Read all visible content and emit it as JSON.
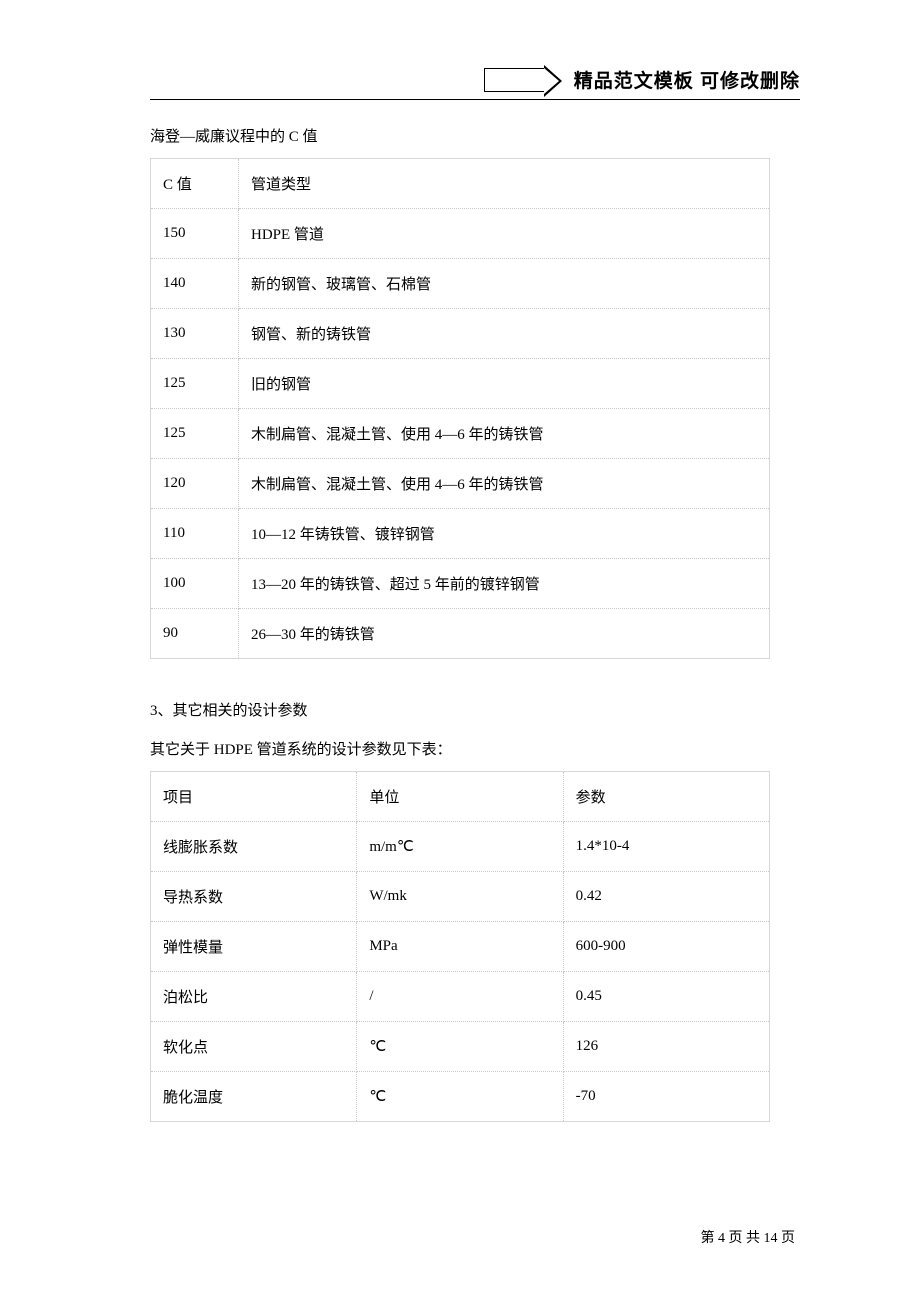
{
  "header": {
    "banner_text": "精品范文模板  可修改删除"
  },
  "table1_caption": "海登—威廉议程中的 C 值",
  "table1": {
    "header": [
      "C 值",
      "管道类型"
    ],
    "rows": [
      [
        "150",
        "HDPE 管道"
      ],
      [
        "140",
        "新的钢管、玻璃管、石棉管"
      ],
      [
        "130",
        "钢管、新的铸铁管"
      ],
      [
        "125",
        "旧的钢管"
      ],
      [
        "125",
        "木制扁管、混凝土管、使用 4—6 年的铸铁管"
      ],
      [
        "120",
        "木制扁管、混凝土管、使用 4—6 年的铸铁管"
      ],
      [
        "110",
        "10—12 年铸铁管、镀锌钢管"
      ],
      [
        "100",
        "13—20 年的铸铁管、超过 5 年前的镀锌钢管"
      ],
      [
        "90",
        "26—30 年的铸铁管"
      ]
    ]
  },
  "section3_heading": "3、其它相关的设计参数",
  "table2_caption": "其它关于 HDPE 管道系统的设计参数见下表：",
  "table2": {
    "header": [
      "项目",
      "单位",
      "参数"
    ],
    "rows": [
      [
        "线膨胀系数",
        "m/m℃",
        "1.4*10-4"
      ],
      [
        "导热系数",
        "W/mk",
        "0.42"
      ],
      [
        "弹性模量",
        "MPa",
        "600-900"
      ],
      [
        "泊松比",
        "/",
        "0.45"
      ],
      [
        "软化点",
        "℃",
        "126"
      ],
      [
        "脆化温度",
        "℃",
        "-70"
      ]
    ]
  },
  "footer": {
    "prefix": "第 ",
    "page": "4",
    "mid": " 页 共 ",
    "total": "14",
    "suffix": " 页"
  }
}
